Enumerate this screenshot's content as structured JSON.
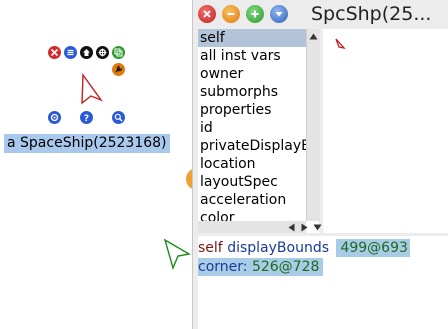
{
  "morph": {
    "label": "a SpaceShip(2523168)"
  },
  "halo_icons": [
    "close-icon",
    "menu-icon",
    "collapse-icon",
    "pickup-icon",
    "duplicate-icon",
    "debug-icon",
    "rotate-icon",
    "help-icon",
    "resize-icon"
  ],
  "window": {
    "title": "SpcShp(25..."
  },
  "inspector": {
    "fields": [
      "self",
      "all inst vars",
      "owner",
      "submorphs",
      "properties",
      "id",
      "privateDisplayB",
      "location",
      "layoutSpec",
      "acceleration",
      "color"
    ],
    "selected_index": 0
  },
  "code": {
    "line1": {
      "receiver": "self",
      "selector": "displayBounds",
      "result": "499@693"
    },
    "line2": {
      "selector": "corner:",
      "result": "526@728"
    }
  },
  "colors": {
    "selection": "#b4c4d8",
    "highlight": "#a8cce6",
    "label_bg": "#a8c8ec"
  }
}
